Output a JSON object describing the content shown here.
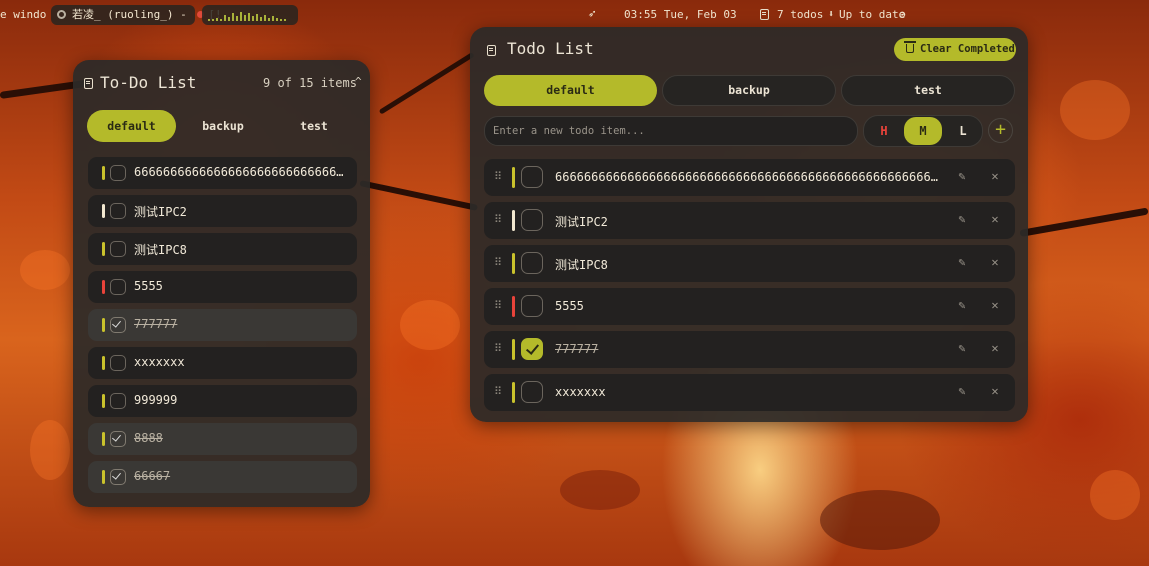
{
  "colors": {
    "accent": "#b4ba2a",
    "priority_high": "#e8433a",
    "priority_medium": "#c9c22c",
    "priority_low": "#f2e8d0",
    "panel_bg": "#2c2a28"
  },
  "topbar": {
    "window_label": "e windo",
    "media_label": "若凌_ (ruoling_) - ",
    "record_label": "[!",
    "clock": "03:55  Tue, Feb 03",
    "todos_count": "7 todos",
    "update_status": "Up to date",
    "icons": [
      "media-icon",
      "record-dot-icon",
      "audio-visualizer",
      "bird-icon",
      "todo-list-icon",
      "update-arrow-icon",
      "check-circle-icon"
    ]
  },
  "left_panel": {
    "title": "To-Do List",
    "count": "9 of 15 items",
    "collapse_icon": "chevron-up-icon",
    "tabs": [
      {
        "label": "default",
        "active": true
      },
      {
        "label": "backup",
        "active": false
      },
      {
        "label": "test",
        "active": false
      }
    ],
    "items": [
      {
        "text": "6666666666666666666666666666666...",
        "priority": "medium",
        "done": false
      },
      {
        "text": "测试IPC2",
        "priority": "low",
        "done": false
      },
      {
        "text": "测试IPC8",
        "priority": "medium",
        "done": false
      },
      {
        "text": "5555",
        "priority": "high",
        "done": false
      },
      {
        "text": "777777",
        "priority": "medium",
        "done": true
      },
      {
        "text": "xxxxxxx",
        "priority": "medium",
        "done": false
      },
      {
        "text": "999999",
        "priority": "medium",
        "done": false
      },
      {
        "text": "8888",
        "priority": "medium",
        "done": true
      },
      {
        "text": "66667",
        "priority": "medium",
        "done": true
      }
    ]
  },
  "right_panel": {
    "title": "Todo List",
    "clear_label": "Clear Completed",
    "tabs": [
      {
        "label": "default",
        "active": true
      },
      {
        "label": "backup",
        "active": false
      },
      {
        "label": "test",
        "active": false
      }
    ],
    "input_placeholder": "Enter a new todo item...",
    "priority_buttons": [
      {
        "label": "H",
        "selected": false
      },
      {
        "label": "M",
        "selected": true
      },
      {
        "label": "L",
        "selected": false
      }
    ],
    "add_label": "+",
    "drag_glyph": "⠿",
    "edit_glyph": "✎",
    "delete_glyph": "✕",
    "items": [
      {
        "text": "6666666666666666666666666666666666666666666666666666666666666...",
        "priority": "medium",
        "done": false
      },
      {
        "text": "测试IPC2",
        "priority": "low",
        "done": false
      },
      {
        "text": "测试IPC8",
        "priority": "medium",
        "done": false
      },
      {
        "text": "5555",
        "priority": "high",
        "done": false
      },
      {
        "text": "777777",
        "priority": "medium",
        "done": true
      },
      {
        "text": "xxxxxxx",
        "priority": "medium",
        "done": false
      }
    ]
  }
}
